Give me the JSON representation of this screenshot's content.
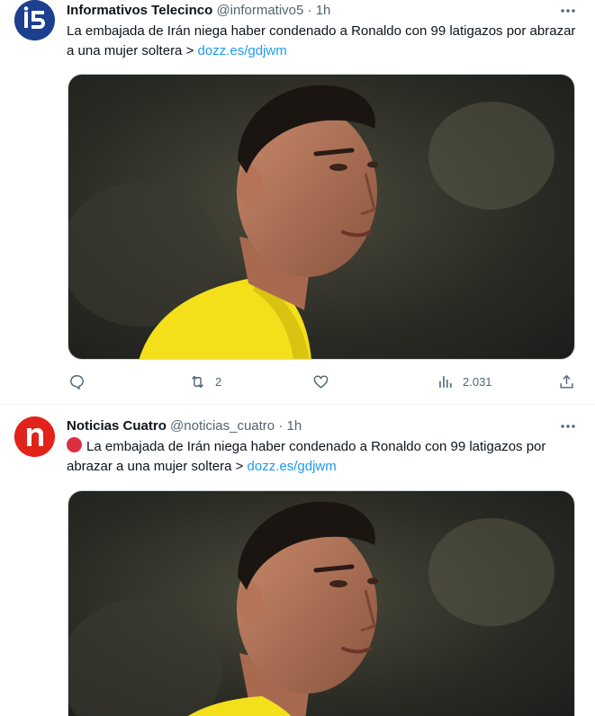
{
  "tweets": [
    {
      "author_name": "Informativos Telecinco",
      "handle": "@informativo5",
      "separator": "·",
      "time": "1h",
      "avatar_icon": "informativos-telecinco-logo-icon",
      "text_main": "La embajada de Irán niega haber condenado a Ronaldo con 99 latigazos por abrazar a una mujer soltera > ",
      "link": "dozz.es/gdjwm",
      "retweets": "2",
      "views": "2.031"
    },
    {
      "author_name": "Noticias Cuatro",
      "handle": "@noticias_cuatro",
      "separator": "·",
      "time": "1h",
      "avatar_icon": "noticias-cuatro-logo-icon",
      "text_main": "La embajada de Irán niega haber condenado a Ronaldo con 99 latigazos por abrazar a una mujer soltera > ",
      "link": "dozz.es/gdjwm"
    }
  ],
  "colors": {
    "link": "#1d9bf0",
    "muted": "#536471",
    "text": "#0f1419",
    "jersey": "#f3e01a"
  }
}
